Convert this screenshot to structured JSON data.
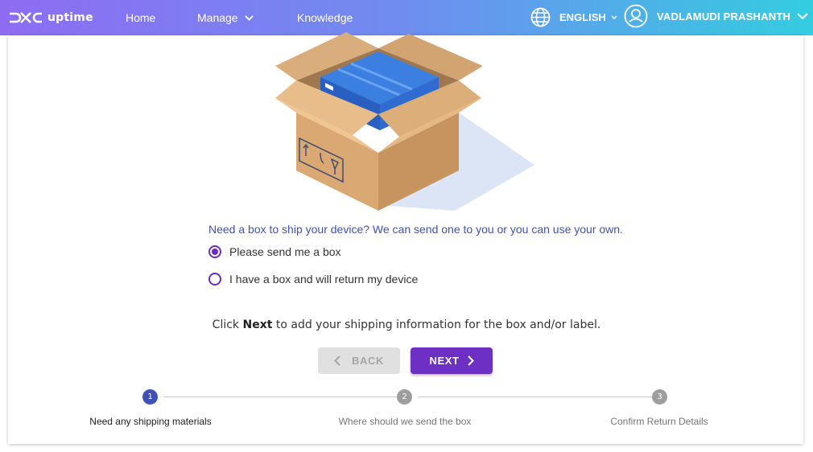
{
  "header": {
    "brand": "uptime",
    "nav": {
      "home": "Home",
      "manage": "Manage",
      "knowledge": "Knowledge"
    },
    "language": "ENGLISH",
    "user_name": "VADLAMUDI PRASHANTH"
  },
  "content": {
    "question": "Need a box to ship your device? We can send one to you or you can use your own.",
    "options": [
      {
        "label": "Please send me a box",
        "selected": true
      },
      {
        "label": "I have a box and will return my device",
        "selected": false
      }
    ],
    "instruction": {
      "prefix": "Click ",
      "bold": "Next",
      "suffix": " to add your shipping information for the box and/or label."
    },
    "buttons": {
      "back": "BACK",
      "next": "NEXT"
    }
  },
  "stepper": {
    "current_step": 1,
    "steps": [
      {
        "number": "1",
        "label": "Need any shipping materials"
      },
      {
        "number": "2",
        "label": "Where should we send the box"
      },
      {
        "number": "3",
        "label": "Confirm Return Details"
      }
    ]
  },
  "colors": {
    "accent": "#6d2fc4",
    "link_text": "#3f51b5",
    "header_gradient_start": "#8e6cf2",
    "header_gradient_end": "#33cde0"
  }
}
